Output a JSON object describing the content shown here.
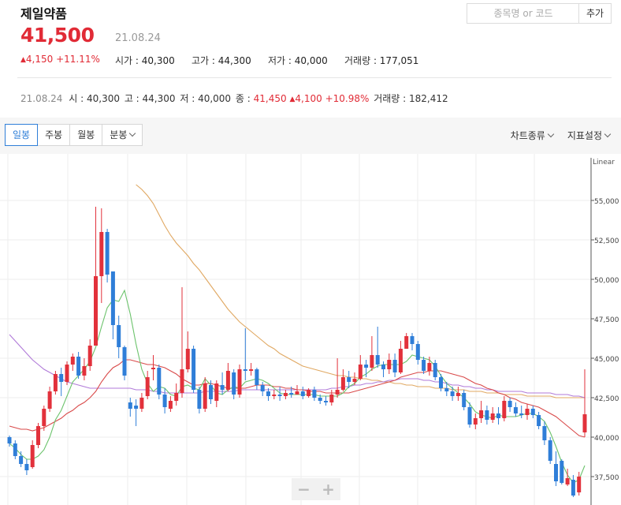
{
  "stock": {
    "name": "제일약품",
    "price": "41,500",
    "price_date": "21.08.24",
    "change_abs": "4,150",
    "change_pct": "+11.11%",
    "stats": [
      {
        "label": "시가",
        "value": "40,300"
      },
      {
        "label": "고가",
        "value": "44,300"
      },
      {
        "label": "저가",
        "value": "40,000"
      },
      {
        "label": "거래량",
        "value": "177,051"
      }
    ]
  },
  "search": {
    "placeholder": "종목명 or 코드",
    "add_label": "추가"
  },
  "daily": {
    "date": "21.08.24",
    "open_label": "시",
    "open": "40,300",
    "high_label": "고",
    "high": "44,300",
    "low_label": "저",
    "low": "40,000",
    "close_label": "종",
    "close": "41,450",
    "change_abs": "4,100",
    "change_pct": "+10.98%",
    "volume_label": "거래량",
    "volume": "182,412"
  },
  "tabs": [
    "일봉",
    "주봉",
    "월봉",
    "분봉"
  ],
  "active_tab": "일봉",
  "menus": {
    "chart_type": "차트종류",
    "indicator": "지표설정"
  },
  "colors": {
    "up": "#e2313b",
    "down": "#2f7ed8",
    "ma5": "#6cc36c",
    "ma20": "#d94a4a",
    "ma60": "#b07ad8",
    "ma120": "#e0a862",
    "accent": "#e12b36"
  },
  "chart_data": {
    "type": "candlestick",
    "scale_label": "Linear",
    "ylim": [
      36000,
      58000
    ],
    "yticks": [
      37500,
      40000,
      42500,
      45000,
      47500,
      50000,
      52500,
      55000
    ],
    "ytick_labels": [
      "37,500",
      "40,000",
      "42,500",
      "45,000",
      "47,500",
      "50,000",
      "52,500",
      "55,000"
    ],
    "grid": true,
    "candles": [
      [
        40000,
        39600,
        40100,
        39400
      ],
      [
        39600,
        38800,
        39800,
        38600
      ],
      [
        38800,
        38300,
        39100,
        38100
      ],
      [
        38300,
        37900,
        38600,
        37600
      ],
      [
        38100,
        39500,
        39800,
        38000
      ],
      [
        39500,
        40700,
        40900,
        39300
      ],
      [
        40700,
        41800,
        42000,
        40400
      ],
      [
        41800,
        42900,
        43200,
        41600
      ],
      [
        42900,
        44000,
        44200,
        42700
      ],
      [
        44000,
        43500,
        44400,
        42600
      ],
      [
        43500,
        44600,
        44800,
        43300
      ],
      [
        44600,
        45100,
        45300,
        44200
      ],
      [
        45100,
        43900,
        45400,
        43700
      ],
      [
        43900,
        44500,
        45000,
        43600
      ],
      [
        44500,
        45800,
        46200,
        44200
      ],
      [
        45800,
        50200,
        54600,
        47200
      ],
      [
        50200,
        53000,
        54500,
        48500
      ],
      [
        53000,
        50300,
        53200,
        49800
      ],
      [
        50500,
        47100,
        50500,
        46200
      ],
      [
        47100,
        45700,
        47700,
        45000
      ],
      [
        45700,
        43900,
        45800,
        43600
      ],
      [
        42200,
        41800,
        42500,
        41300
      ],
      [
        42000,
        41800,
        42400,
        40700
      ],
      [
        41800,
        42500,
        42800,
        41600
      ],
      [
        42600,
        43800,
        44200,
        42400
      ],
      [
        44300,
        44400,
        45200,
        43600
      ],
      [
        44400,
        42700,
        44600,
        42400
      ],
      [
        42700,
        41900,
        43100,
        41500
      ],
      [
        41800,
        42300,
        42600,
        41600
      ],
      [
        42300,
        42800,
        43400,
        42000
      ],
      [
        42800,
        44300,
        49500,
        42500
      ],
      [
        44300,
        45600,
        46700,
        44100
      ],
      [
        45600,
        43000,
        45800,
        42800
      ],
      [
        43000,
        41800,
        43200,
        41500
      ],
      [
        41800,
        43400,
        43800,
        41600
      ],
      [
        43300,
        42400,
        43600,
        42100
      ],
      [
        42300,
        43400,
        43600,
        41900
      ],
      [
        43300,
        43000,
        44100,
        42700
      ],
      [
        43000,
        44200,
        44700,
        42900
      ],
      [
        44100,
        42700,
        44300,
        42400
      ],
      [
        42700,
        44300,
        44600,
        42500
      ],
      [
        44300,
        44200,
        46900,
        43600
      ],
      [
        44200,
        44300,
        44700,
        43900
      ],
      [
        44300,
        43300,
        44400,
        43000
      ],
      [
        43300,
        42900,
        43500,
        42600
      ],
      [
        42900,
        42600,
        43100,
        42300
      ],
      [
        42600,
        42700,
        43000,
        42400
      ],
      [
        42700,
        42600,
        43200,
        42300
      ],
      [
        42600,
        42800,
        43000,
        42400
      ],
      [
        42800,
        42700,
        43200,
        42500
      ],
      [
        42700,
        42900,
        43300,
        42700
      ],
      [
        42900,
        42600,
        43200,
        42400
      ],
      [
        42600,
        43000,
        43100,
        42500
      ],
      [
        43000,
        42500,
        43200,
        42300
      ],
      [
        42500,
        42300,
        42700,
        42100
      ],
      [
        42300,
        42200,
        42600,
        42000
      ],
      [
        42200,
        42700,
        43000,
        42000
      ],
      [
        42700,
        43000,
        45000,
        42500
      ],
      [
        43000,
        43800,
        44300,
        42900
      ],
      [
        43800,
        43500,
        44200,
        43100
      ],
      [
        43500,
        43700,
        44100,
        43300
      ],
      [
        43700,
        44600,
        45200,
        43600
      ],
      [
        44600,
        44400,
        44900,
        43800
      ],
      [
        44400,
        45200,
        46400,
        44200
      ],
      [
        45200,
        44600,
        47000,
        44400
      ],
      [
        44600,
        44300,
        44800,
        43800
      ],
      [
        44300,
        44900,
        45300,
        44000
      ],
      [
        44900,
        44100,
        45300,
        43800
      ],
      [
        44100,
        45600,
        46100,
        44000
      ],
      [
        45600,
        46400,
        46600,
        45700
      ],
      [
        46400,
        45900,
        46600,
        45500
      ],
      [
        45900,
        44900,
        46100,
        44600
      ],
      [
        44900,
        44200,
        45100,
        44000
      ],
      [
        44200,
        44700,
        45100,
        43900
      ],
      [
        44700,
        43800,
        44900,
        43600
      ],
      [
        43800,
        43100,
        44000,
        42900
      ],
      [
        43100,
        42900,
        43500,
        42600
      ],
      [
        42900,
        42600,
        43200,
        42300
      ],
      [
        42600,
        42800,
        43200,
        42300
      ],
      [
        42800,
        41900,
        43000,
        41700
      ],
      [
        41900,
        40800,
        42200,
        40600
      ],
      [
        40800,
        41200,
        41500,
        40500
      ],
      [
        41200,
        41700,
        42300,
        40900
      ],
      [
        41700,
        41100,
        42000,
        40800
      ],
      [
        41100,
        41500,
        41900,
        40900
      ],
      [
        41500,
        41200,
        41900,
        40800
      ],
      [
        41200,
        42300,
        42600,
        41000
      ],
      [
        42300,
        41900,
        42500,
        41600
      ],
      [
        41900,
        41500,
        42200,
        41300
      ],
      [
        41500,
        41400,
        42000,
        41200
      ],
      [
        41400,
        41800,
        42100,
        41100
      ],
      [
        41800,
        41400,
        42000,
        41200
      ],
      [
        41400,
        40700,
        41600,
        40500
      ],
      [
        40700,
        39800,
        41000,
        39500
      ],
      [
        39800,
        38500,
        40000,
        38300
      ],
      [
        38300,
        37200,
        39100,
        36900
      ],
      [
        38500,
        37100,
        38600,
        37000
      ],
      [
        37000,
        37400,
        38000,
        36900
      ],
      [
        37300,
        36300,
        37600,
        36200
      ],
      [
        36500,
        37500,
        37800,
        36300
      ],
      [
        40300,
        41450,
        44300,
        40000
      ]
    ],
    "ma5": [
      39600,
      39300,
      38900,
      38600,
      38600,
      38800,
      39200,
      40000,
      41100,
      41700,
      42600,
      43500,
      43900,
      44300,
      44800,
      45700,
      47000,
      48200,
      48700,
      48600,
      49300,
      47800,
      45900,
      44300,
      43400,
      42900,
      43200,
      43100,
      42700,
      42600,
      43200,
      43300,
      43100,
      43000,
      43700,
      43300,
      42800,
      42700,
      43000,
      43200,
      43100,
      43500,
      43600,
      43700,
      43600,
      43400,
      43100,
      42800,
      42700,
      42700,
      42700,
      42700,
      42700,
      42700,
      42600,
      42600,
      42600,
      42600,
      42800,
      43200,
      43400,
      43800,
      44000,
      44300,
      44500,
      44600,
      44600,
      44600,
      44600,
      44800,
      45200,
      45100,
      45000,
      44900,
      44500,
      43900,
      43400,
      43100,
      42800,
      42500,
      42100,
      41600,
      41400,
      41300,
      41200,
      41400,
      41300,
      41300,
      41300,
      41400,
      41500,
      41500,
      41300,
      41000,
      40300,
      39400,
      38400,
      37600,
      37100,
      37300,
      38200
    ],
    "ma20": [
      40700,
      40600,
      40500,
      40500,
      40400,
      40500,
      40600,
      40800,
      41000,
      41200,
      41500,
      41700,
      42000,
      42200,
      42500,
      42900,
      43500,
      44000,
      44400,
      44600,
      44900,
      44900,
      44800,
      44700,
      44600,
      44600,
      44500,
      44400,
      44200,
      44000,
      43700,
      43500,
      43300,
      43300,
      43400,
      43400,
      43300,
      43200,
      43100,
      43100,
      43100,
      43100,
      43200,
      43300,
      43300,
      43300,
      43200,
      43200,
      43100,
      43100,
      43000,
      43000,
      42900,
      42900,
      42900,
      42800,
      42800,
      42800,
      42800,
      42800,
      42900,
      43000,
      43100,
      43200,
      43300,
      43400,
      43500,
      43600,
      43800,
      43900,
      44000,
      44100,
      44100,
      44200,
      44200,
      44200,
      44100,
      44000,
      43900,
      43800,
      43600,
      43400,
      43300,
      43100,
      43000,
      42800,
      42700,
      42500,
      42400,
      42200,
      42100,
      42000,
      41900,
      41700,
      41500,
      41300,
      41000,
      40700,
      40400,
      40100,
      40000
    ],
    "ma60": [
      46500,
      46100,
      45700,
      45300,
      44900,
      44600,
      44300,
      44100,
      43900,
      43700,
      43500,
      43400,
      43300,
      43200,
      43100,
      43100,
      43100,
      43100,
      43100,
      43100,
      43100,
      43100,
      43000,
      43000,
      43000,
      42900,
      42900,
      42800,
      42800,
      42800,
      42800,
      42800,
      42800,
      42800,
      42900,
      42900,
      42900,
      42900,
      42900,
      42900,
      43000,
      43000,
      43000,
      43000,
      43000,
      43000,
      43000,
      43000,
      43000,
      43000,
      43000,
      43000,
      43000,
      43000,
      43000,
      43000,
      43100,
      43100,
      43200,
      43200,
      43300,
      43300,
      43400,
      43400,
      43500,
      43500,
      43600,
      43600,
      43700,
      43700,
      43700,
      43700,
      43600,
      43600,
      43500,
      43500,
      43400,
      43300,
      43300,
      43200,
      43200,
      43100,
      43100,
      43000,
      43000,
      42900,
      42900,
      42900,
      42900,
      42900,
      42800,
      42800,
      42800,
      42800,
      42800,
      42700,
      42700,
      42700,
      42600,
      42600,
      42500
    ],
    "ma120": [
      null,
      null,
      null,
      null,
      null,
      null,
      null,
      null,
      null,
      null,
      null,
      null,
      null,
      null,
      null,
      null,
      null,
      null,
      null,
      null,
      null,
      null,
      56000,
      55700,
      55300,
      54800,
      54100,
      53400,
      52800,
      52300,
      51900,
      51500,
      51000,
      50600,
      50100,
      49600,
      49100,
      48600,
      48100,
      47700,
      47300,
      47000,
      46700,
      46400,
      46100,
      45800,
      45600,
      45300,
      45100,
      44900,
      44700,
      44500,
      44400,
      44300,
      44200,
      44100,
      44000,
      43900,
      43900,
      43800,
      43800,
      43700,
      43700,
      43600,
      43600,
      43500,
      43500,
      43400,
      43400,
      43300,
      43300,
      43200,
      43200,
      43200,
      43100,
      43100,
      43100,
      43000,
      43000,
      43000,
      42900,
      42900,
      42900,
      42800,
      42800,
      42800,
      42700,
      42700,
      42700,
      42700,
      42600,
      42600,
      42600,
      42600,
      42600,
      42500,
      42500,
      42500,
      42500,
      42500,
      42500
    ]
  }
}
